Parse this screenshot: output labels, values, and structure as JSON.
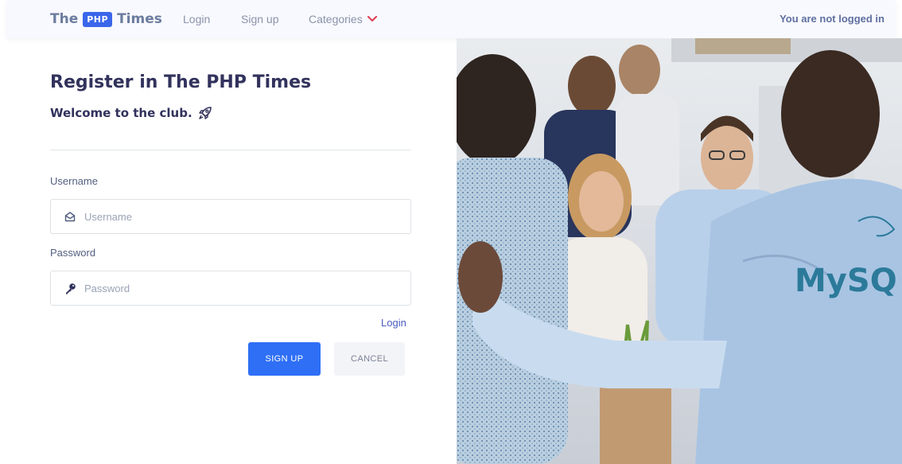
{
  "navbar": {
    "brand_left": "The",
    "brand_badge": "PHP",
    "brand_right": "Times",
    "links": [
      {
        "label": "Login"
      },
      {
        "label": "Sign up"
      },
      {
        "label": "Categories"
      }
    ],
    "status": "You are not logged in"
  },
  "form": {
    "title": "Register in The PHP Times",
    "subtitle": "Welcome to the club.",
    "username_label": "Username",
    "username_placeholder": "Username",
    "password_label": "Password",
    "password_placeholder": "Password",
    "login_link": "Login",
    "signup_button": "SIGN UP",
    "cancel_button": "CANCEL"
  },
  "photo": {
    "shirt_text": "MySQ"
  },
  "colors": {
    "accent": "#2e6ff5",
    "brand_badge": "#3a66ea",
    "heading": "#32325d",
    "chevron": "#e0445a"
  }
}
